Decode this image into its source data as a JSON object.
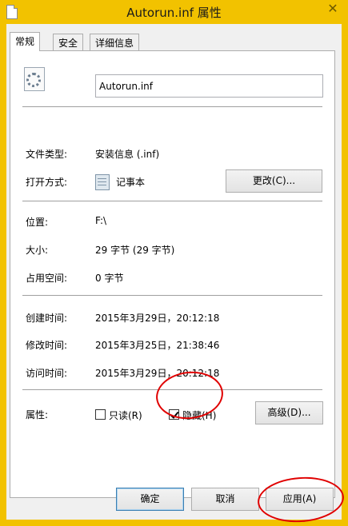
{
  "window": {
    "title": "Autorun.inf 属性",
    "close_glyph": "✕"
  },
  "tabs": [
    {
      "label": "常规",
      "active": true
    },
    {
      "label": "安全",
      "active": false
    },
    {
      "label": "详细信息",
      "active": false
    }
  ],
  "file": {
    "name": "Autorun.inf",
    "icon": "settings-file-icon"
  },
  "fields": {
    "type_label": "文件类型:",
    "type_value": "安装信息 (.inf)",
    "open_label": "打开方式:",
    "open_value": "记事本",
    "open_icon": "notepad-icon",
    "change_button": "更改(C)...",
    "location_label": "位置:",
    "location_value": "F:\\",
    "size_label": "大小:",
    "size_value": "29 字节 (29 字节)",
    "disk_label": "占用空间:",
    "disk_value": "0 字节",
    "created_label": "创建时间:",
    "created_value": "2015年3月29日，20:12:18",
    "modified_label": "修改时间:",
    "modified_value": "2015年3月25日，21:38:46",
    "accessed_label": "访问时间:",
    "accessed_value": "2015年3月29日，20:12:18"
  },
  "attributes": {
    "label": "属性:",
    "readonly": {
      "label": "只读(R)",
      "checked": false
    },
    "hidden": {
      "label": "隐藏(H)",
      "checked": true
    },
    "advanced_button": "高级(D)..."
  },
  "buttons": {
    "ok": "确定",
    "cancel": "取消",
    "apply": "应用(A)"
  },
  "colors": {
    "window_frame": "#f2c200",
    "annotation": "#e00000",
    "default_button_border": "#3c7fb1"
  }
}
